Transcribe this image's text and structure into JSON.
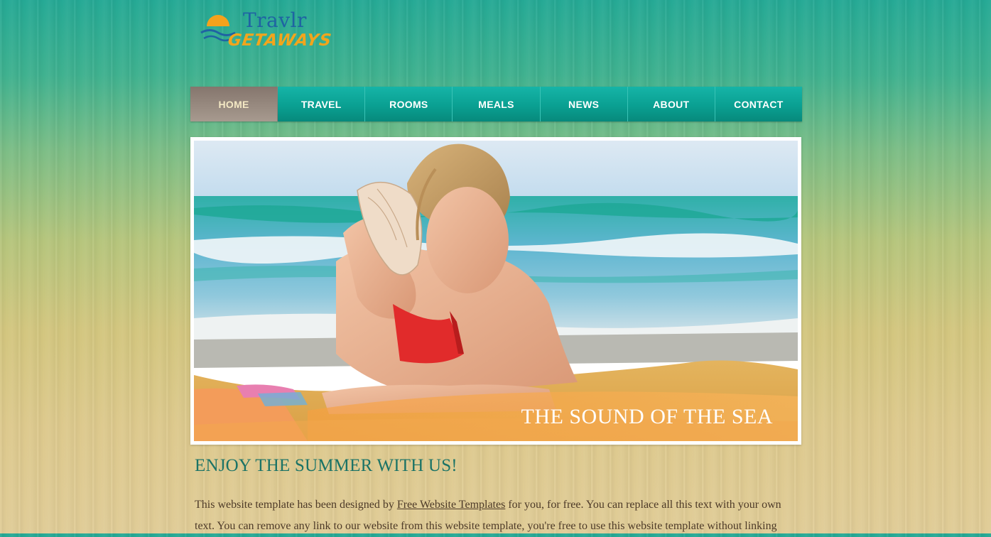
{
  "logo": {
    "name_line1": "Travlr",
    "name_line2": "GETAWAYS"
  },
  "nav": {
    "items": [
      {
        "label": "HOME",
        "active": true
      },
      {
        "label": "TRAVEL",
        "active": false
      },
      {
        "label": "ROOMS",
        "active": false
      },
      {
        "label": "MEALS",
        "active": false
      },
      {
        "label": "NEWS",
        "active": false
      },
      {
        "label": "ABOUT",
        "active": false
      },
      {
        "label": "CONTACT",
        "active": false
      }
    ]
  },
  "hero": {
    "caption": "THE SOUND OF THE SEA"
  },
  "main": {
    "headline": "ENJOY THE SUMMER WITH US!",
    "intro_before_link": "This website template has been designed by ",
    "intro_link": "Free Website Templates",
    "intro_after_link": " for you, for free. You can replace all this text with your own text. You can remove any link to our website from this website template, you're free to use this website template without linking"
  },
  "colors": {
    "nav_teal": "#0aa092",
    "nav_active": "#9a8c82",
    "headline": "#1b7366",
    "logo_blue": "#1f63a3",
    "logo_orange": "#f2a51c"
  }
}
